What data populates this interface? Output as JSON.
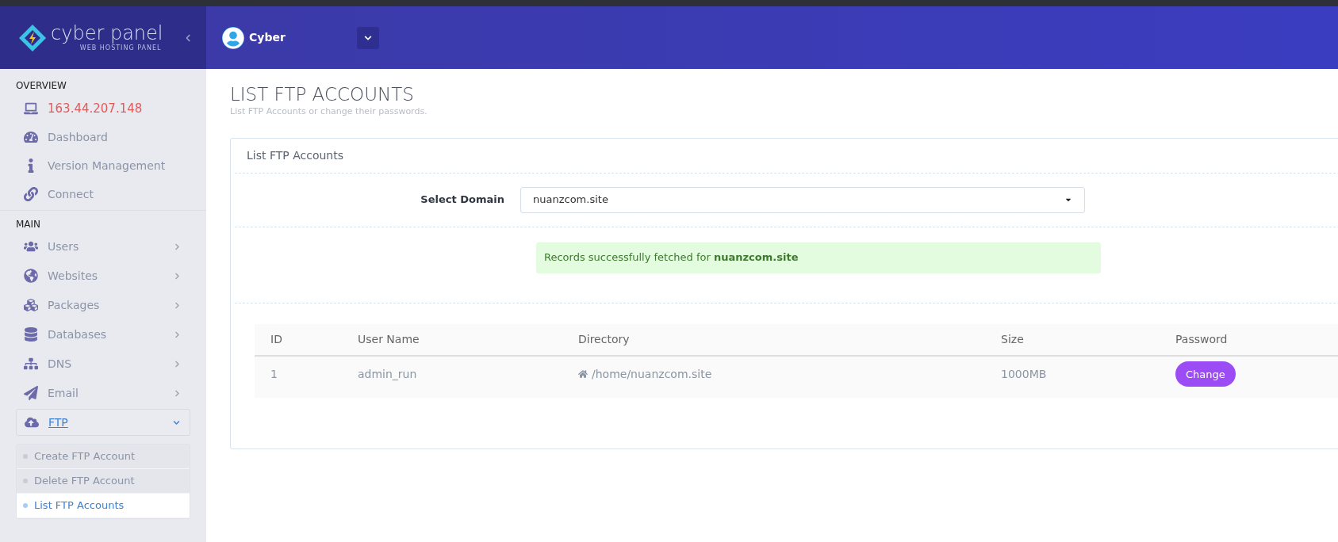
{
  "brand": {
    "name": "cyber panel",
    "tagline": "WEB HOSTING PANEL"
  },
  "user": {
    "name": "Cyber"
  },
  "sidebar": {
    "sections": [
      {
        "title": "OVERVIEW",
        "items": [
          {
            "label": "163.44.207.148",
            "kind": "ip"
          },
          {
            "label": "Dashboard",
            "kind": "link"
          },
          {
            "label": "Version Management",
            "kind": "link"
          },
          {
            "label": "Connect",
            "kind": "link"
          }
        ]
      },
      {
        "title": "MAIN",
        "items": [
          {
            "label": "Users",
            "kind": "menu",
            "expanded": false
          },
          {
            "label": "Websites",
            "kind": "menu",
            "expanded": false
          },
          {
            "label": "Packages",
            "kind": "menu",
            "expanded": false
          },
          {
            "label": "Databases",
            "kind": "menu",
            "expanded": false
          },
          {
            "label": "DNS",
            "kind": "menu",
            "expanded": false
          },
          {
            "label": "Email",
            "kind": "menu",
            "expanded": false
          },
          {
            "label": "FTP",
            "kind": "menu",
            "expanded": true,
            "children": [
              {
                "label": "Create FTP Account",
                "selected": false
              },
              {
                "label": "Delete FTP Account",
                "selected": false
              },
              {
                "label": "List FTP Accounts",
                "selected": true
              }
            ]
          }
        ]
      }
    ]
  },
  "page": {
    "title": "LIST FTP ACCOUNTS",
    "subtitle": "List FTP Accounts or change their passwords."
  },
  "card": {
    "title": "List FTP Accounts",
    "select_label": "Select Domain",
    "select_value": "nuanzcom.site",
    "alert": "Records successfully fetched for **nuanzcom.site**"
  },
  "table": {
    "columns": [
      "ID",
      "User Name",
      "Directory",
      "Size",
      "Password"
    ],
    "rows": [
      {
        "id": "1",
        "user": "admin_run",
        "directory": "/home/nuanzcom.site",
        "size": "1000MB",
        "action": "Change"
      }
    ]
  }
}
